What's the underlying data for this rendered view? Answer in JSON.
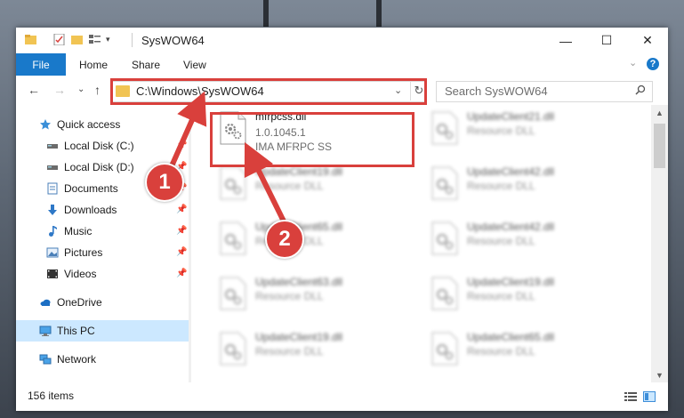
{
  "window": {
    "title": "SysWOW64",
    "controls": {
      "minimize": "—",
      "maximize": "☐",
      "close": "✕"
    }
  },
  "ribbon": {
    "tabs": [
      "File",
      "Home",
      "Share",
      "View"
    ],
    "collapse": "⌄",
    "help": "?"
  },
  "nav": {
    "back": "←",
    "forward": "→",
    "recent": "⌄",
    "up": "↑",
    "address": "C:\\Windows\\SysWOW64",
    "address_dropdown": "⌄",
    "refresh": "↻",
    "search_placeholder": "Search SysWOW64"
  },
  "sidebar": {
    "items": [
      {
        "label": "Quick access",
        "icon": "star-icon"
      },
      {
        "label": "Local Disk (C:)",
        "icon": "drive-icon"
      },
      {
        "label": "Local Disk (D:)",
        "icon": "drive-icon"
      },
      {
        "label": "Documents",
        "icon": "documents-icon"
      },
      {
        "label": "Downloads",
        "icon": "downloads-icon"
      },
      {
        "label": "Music",
        "icon": "music-icon"
      },
      {
        "label": "Pictures",
        "icon": "pictures-icon"
      },
      {
        "label": "Videos",
        "icon": "videos-icon"
      },
      {
        "label": "OneDrive",
        "icon": "cloud-icon"
      },
      {
        "label": "This PC",
        "icon": "computer-icon"
      },
      {
        "label": "Network",
        "icon": "network-icon"
      }
    ]
  },
  "files": [
    {
      "name": "mfrpcss.dll",
      "version": "1.0.1045.1",
      "desc": "IMA MFRPC SS"
    },
    {
      "name": "UpdateClient21.dll",
      "desc": "Resource DLL"
    },
    {
      "name": "UpdateClient19.dll",
      "desc": "Resource DLL"
    },
    {
      "name": "UpdateClient42.dll",
      "desc": "Resource DLL"
    },
    {
      "name": "UpdateClient65.dll",
      "desc": "Resource DLL"
    },
    {
      "name": "UpdateClient42.dll",
      "desc": "Resource DLL"
    },
    {
      "name": "UpdateClient63.dll",
      "desc": "Resource DLL"
    },
    {
      "name": "UpdateClient19.dll",
      "desc": "Resource DLL"
    },
    {
      "name": "UpdateClient19.dll",
      "desc": "Resource DLL"
    },
    {
      "name": "UpdateClient65.dll",
      "desc": "Resource DLL"
    }
  ],
  "status": {
    "item_count": "156 items"
  },
  "annotations": {
    "badge1": "1",
    "badge2": "2"
  },
  "colors": {
    "accent": "#1979ca",
    "highlight": "#d9403c",
    "selected": "#cce8ff"
  }
}
